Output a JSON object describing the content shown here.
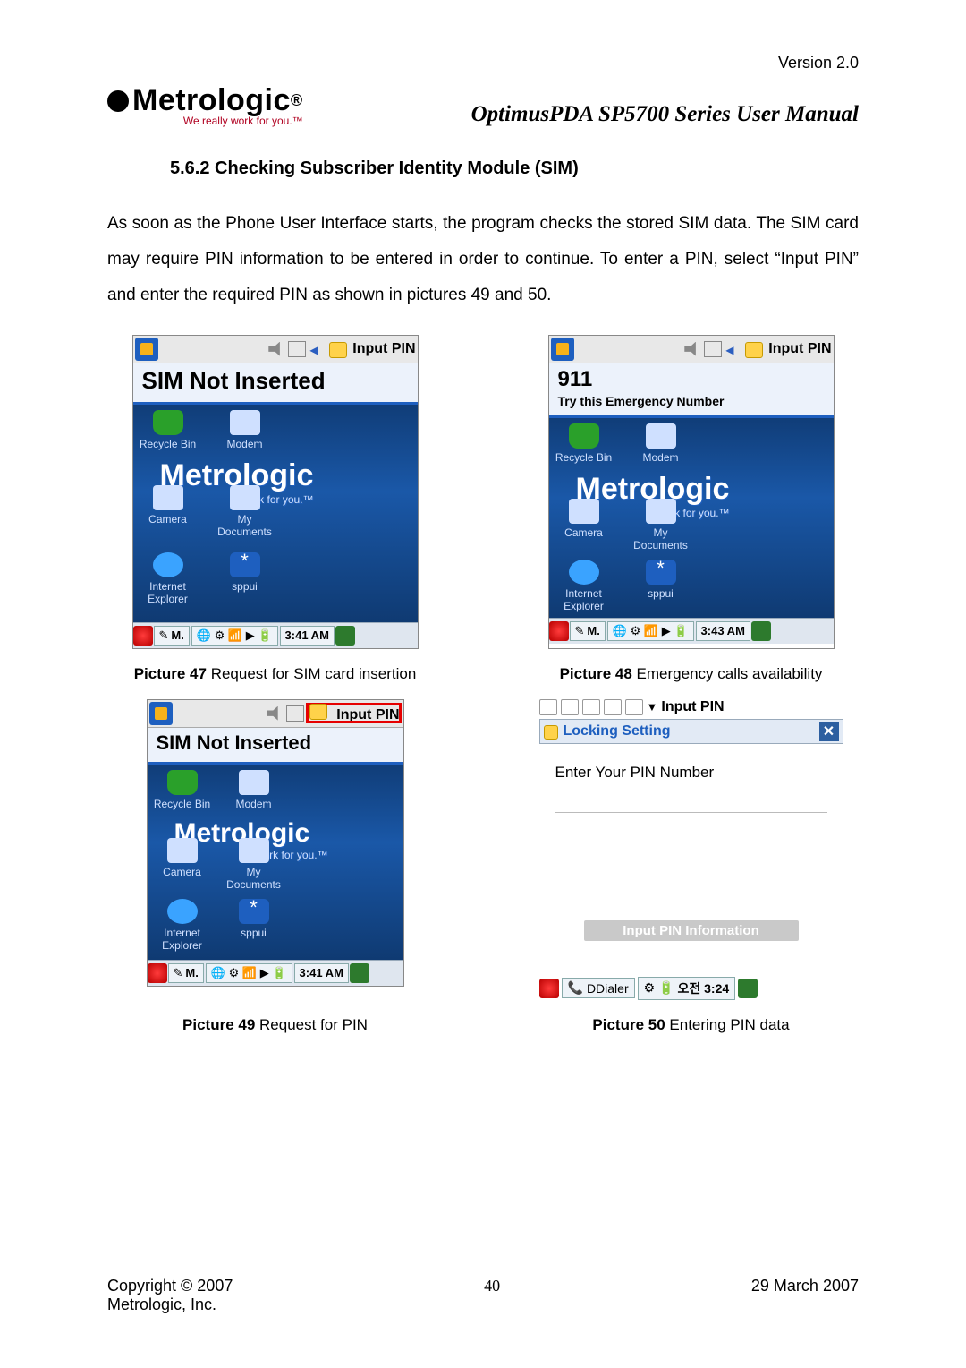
{
  "header": {
    "version": "Version 2.0"
  },
  "logo": {
    "main": "Metrologic",
    "sub": "We really work for you.™"
  },
  "doc_title": "OptimusPDA SP5700 Series User Manual",
  "section": {
    "heading": "5.6.2 Checking Subscriber Identity Module (SIM)"
  },
  "body": "As soon as the Phone User Interface starts, the program checks the stored SIM data. The SIM card may require PIN information to be entered in order to continue.  To enter a PIN, select “Input PIN” and enter the required PIN as shown in pictures 49 and 50.",
  "pda_common": {
    "title": "Input PIN",
    "desktop_icons": {
      "recycle": "Recycle Bin",
      "modem": "Modem",
      "camera": "Camera",
      "mydocs": "My Documents",
      "ie": "Internet Explorer",
      "sppui": "sppui"
    },
    "watermark": "Metrologic",
    "watermark_sub": "ork for you.™",
    "task_mode": "M."
  },
  "fig47": {
    "banner_line1": "SIM Not Inserted",
    "task_time": "3:41 AM",
    "caption_bold": "Picture 47",
    "caption_rest": " Request for SIM card insertion"
  },
  "fig48": {
    "banner_line1": "911",
    "banner_line2": "Try this Emergency Number",
    "task_time": "3:43 AM",
    "caption_bold": "Picture 48",
    "caption_rest": " Emergency calls availability"
  },
  "fig49": {
    "banner_line1": "SIM Not Inserted",
    "task_time": "3:41 AM",
    "caption_bold": "Picture 49",
    "caption_rest": " Request for PIN"
  },
  "fig50": {
    "top_title": "Input PIN",
    "sub_title": "Locking Setting",
    "prompt": "Enter Your PIN Number",
    "button": "Input PIN Information",
    "task_app": "DDialer",
    "task_time": "오전 3:24",
    "caption_bold": "Picture 50",
    "caption_rest": " Entering PIN data"
  },
  "footer": {
    "left1": "Copyright © 2007",
    "left2": "Metrologic, Inc.",
    "mid": "40",
    "right": "29 March 2007"
  }
}
